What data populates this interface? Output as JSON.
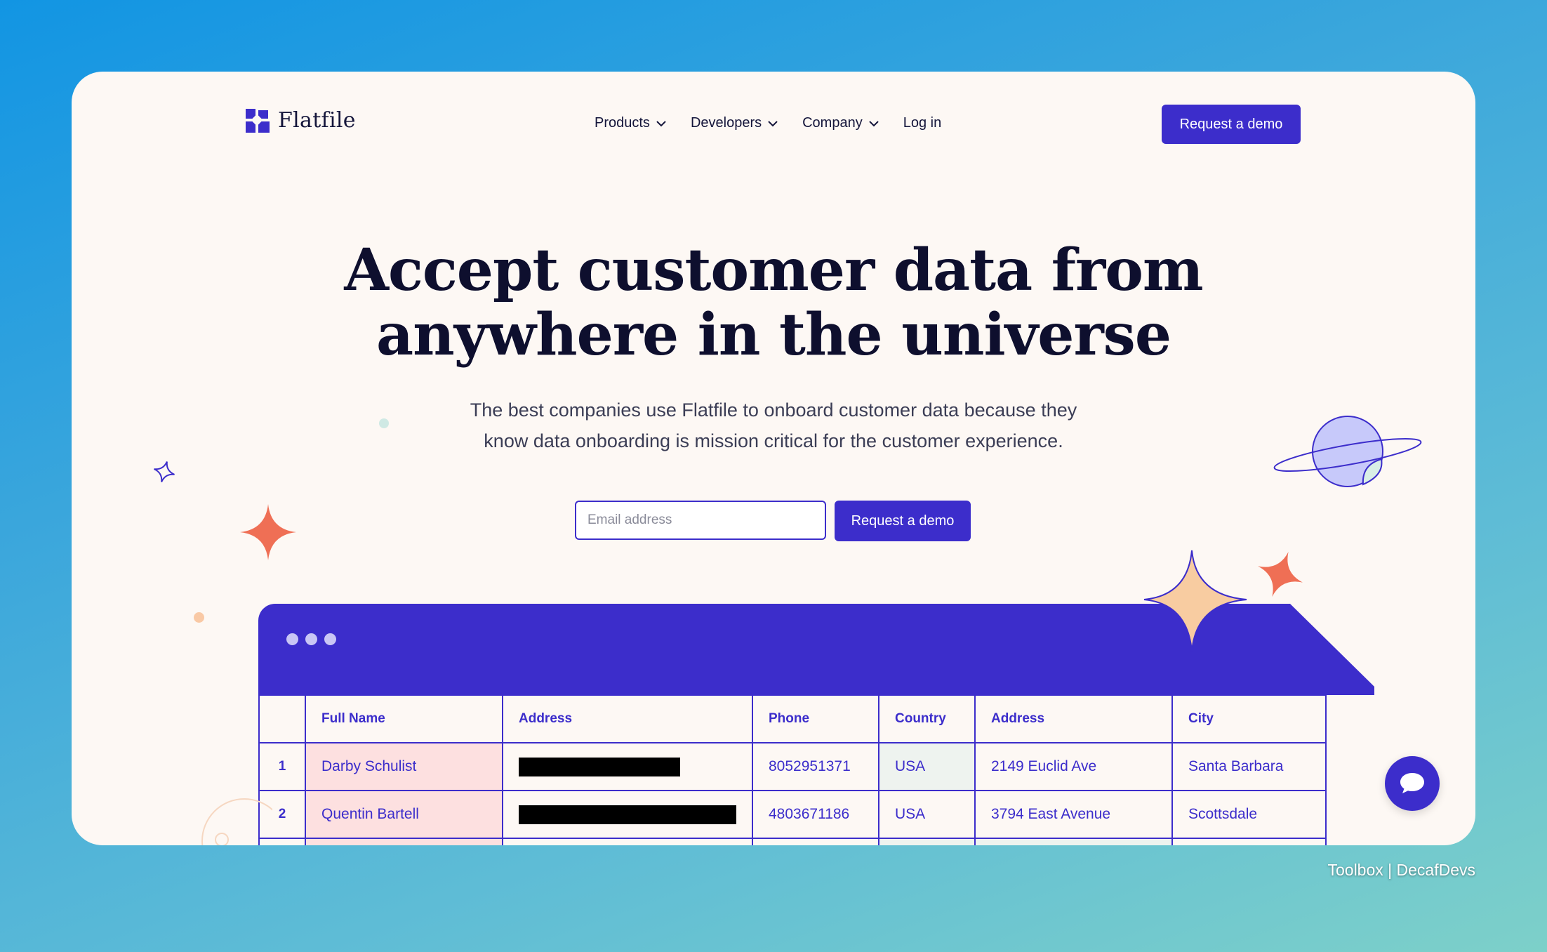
{
  "brand": {
    "name": "Flatfile",
    "color": "#3c2dcb"
  },
  "nav": {
    "items": [
      {
        "label": "Products",
        "has_dropdown": true
      },
      {
        "label": "Developers",
        "has_dropdown": true
      },
      {
        "label": "Company",
        "has_dropdown": true
      },
      {
        "label": "Log in",
        "has_dropdown": false
      }
    ],
    "cta": "Request a demo"
  },
  "hero": {
    "headline_line1": "Accept customer data from",
    "headline_line2": "anywhere in the universe",
    "sub_line1": "The best companies use Flatfile to onboard customer data because they",
    "sub_line2": "know data onboarding is mission critical for the customer experience.",
    "email_placeholder": "Email address",
    "cta": "Request a demo"
  },
  "table": {
    "headers": [
      "",
      "Full Name",
      "Address",
      "Phone",
      "Country",
      "Address",
      "City"
    ],
    "rows": [
      {
        "num": "1",
        "full_name": "Darby Schulist",
        "address": "",
        "phone": "8052951371",
        "country": "USA",
        "street": "2149 Euclid Ave",
        "city": "Santa Barbara"
      },
      {
        "num": "2",
        "full_name": "Quentin Bartell",
        "address": "",
        "phone": "4803671186",
        "country": "USA",
        "street": "3794 East Avenue",
        "city": "Scottsdale"
      }
    ]
  },
  "icons": [
    "chevron-down-icon",
    "chat-bubble-icon",
    "planet-icon",
    "sparkle-icon",
    "window-dots-icon"
  ],
  "credit": "Toolbox | DecafDevs"
}
